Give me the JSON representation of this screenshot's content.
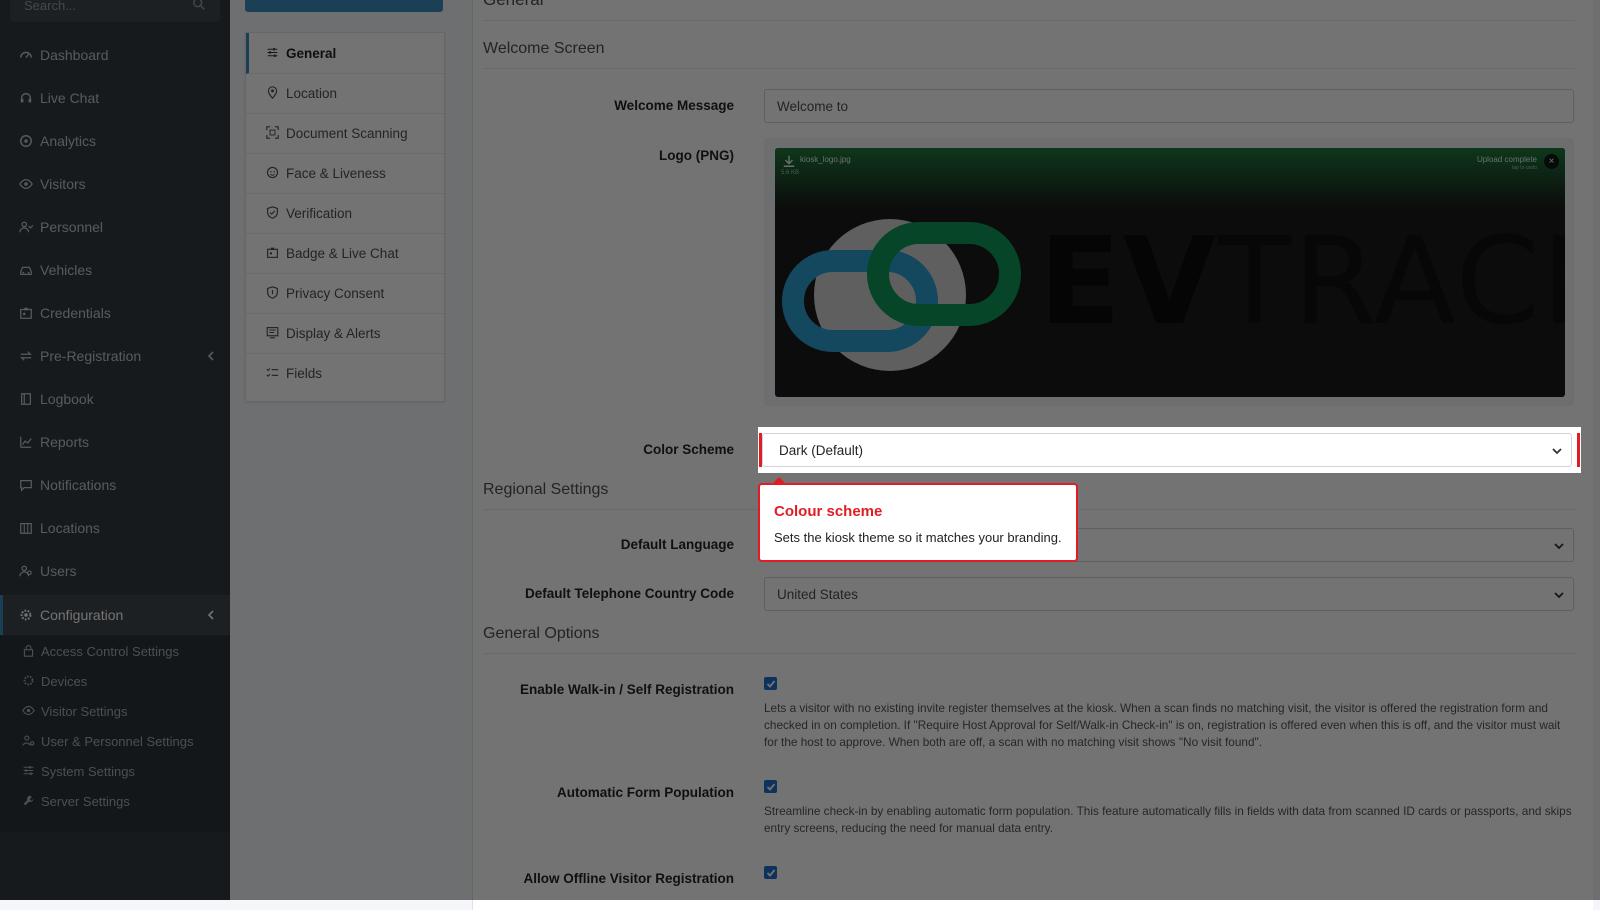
{
  "sidebar": {
    "search_placeholder": "Search...",
    "items": [
      {
        "label": "Dashboard",
        "icon": "dashboard-icon"
      },
      {
        "label": "Live Chat",
        "icon": "headset-icon"
      },
      {
        "label": "Analytics",
        "icon": "analytics-icon"
      },
      {
        "label": "Visitors",
        "icon": "eye-icon"
      },
      {
        "label": "Personnel",
        "icon": "user-group-icon"
      },
      {
        "label": "Vehicles",
        "icon": "car-icon"
      },
      {
        "label": "Credentials",
        "icon": "id-card-icon"
      },
      {
        "label": "Pre-Registration",
        "icon": "arrows-icon"
      },
      {
        "label": "Logbook",
        "icon": "book-icon"
      },
      {
        "label": "Reports",
        "icon": "chart-icon"
      },
      {
        "label": "Notifications",
        "icon": "message-icon"
      },
      {
        "label": "Locations",
        "icon": "building-icon"
      },
      {
        "label": "Users",
        "icon": "users-icon"
      },
      {
        "label": "Configuration",
        "icon": "cog-icon"
      }
    ],
    "sub_items": [
      {
        "label": "Access Control Settings",
        "icon": "lock-icon"
      },
      {
        "label": "Devices",
        "icon": "gear-icon"
      },
      {
        "label": "Visitor Settings",
        "icon": "eye-icon"
      },
      {
        "label": "User & Personnel Settings",
        "icon": "user-cog-icon"
      },
      {
        "label": "System Settings",
        "icon": "sliders-icon"
      },
      {
        "label": "Server Settings",
        "icon": "wrench-icon"
      }
    ]
  },
  "settings_menu": {
    "items": [
      {
        "label": "General",
        "icon": "sliders-icon"
      },
      {
        "label": "Location",
        "icon": "location-pin-icon"
      },
      {
        "label": "Document Scanning",
        "icon": "scan-icon"
      },
      {
        "label": "Face & Liveness",
        "icon": "face-icon"
      },
      {
        "label": "Verification",
        "icon": "shield-check-icon"
      },
      {
        "label": "Badge & Live Chat",
        "icon": "badge-icon"
      },
      {
        "label": "Privacy Consent",
        "icon": "shield-icon"
      },
      {
        "label": "Display & Alerts",
        "icon": "display-icon"
      },
      {
        "label": "Fields",
        "icon": "list-check-icon"
      }
    ]
  },
  "main": {
    "page_title": "General",
    "welcome_section": "Welcome Screen",
    "welcome_message_label": "Welcome Message",
    "welcome_message_value": "Welcome to",
    "logo_label": "Logo (PNG)",
    "logo_file_name": "kiosk_logo.jpg",
    "logo_file_size": "5.6 KB",
    "logo_upload_status": "Upload complete",
    "logo_upload_hint": "tap to undo",
    "logo_wordmark_bold": "EV",
    "logo_wordmark_light": "TRACK",
    "color_scheme_label": "Color Scheme",
    "color_scheme_value": "Dark (Default)",
    "regional_section": "Regional Settings",
    "default_language_label": "Default Language",
    "default_language_value": "",
    "telephone_label": "Default Telephone Country Code",
    "telephone_value": "United States",
    "general_options_section": "General Options",
    "walkin_label": "Enable Walk-in / Self Registration",
    "walkin_help": "Lets a visitor with no existing invite register themselves at the kiosk. When a scan finds no matching visit, the visitor is offered the registration form and checked in on completion. If \"Require Host Approval for Self/Walk-in Check-in\" is on, registration is offered even when this is off, and the visitor must wait for the host to approve. When both are off, a scan with no matching visit shows \"No visit found\".",
    "autofill_label": "Automatic Form Population",
    "autofill_help": "Streamline check-in by enabling automatic form population. This feature automatically fills in fields with data from scanned ID cards or passports, and skips entry screens, reducing the need for manual data entry.",
    "offline_label": "Allow Offline Visitor Registration"
  },
  "tooltip": {
    "title": "Colour scheme",
    "text": "Sets the kiosk theme so it matches your branding."
  },
  "colors": {
    "sidebar_bg": "#343a40",
    "accent": "#3c8dbc",
    "highlight_red": "#e11d24",
    "checkbox_blue": "#1f6fd1",
    "logo_blue": "#2a9fd0",
    "logo_green": "#0f9a5a"
  }
}
